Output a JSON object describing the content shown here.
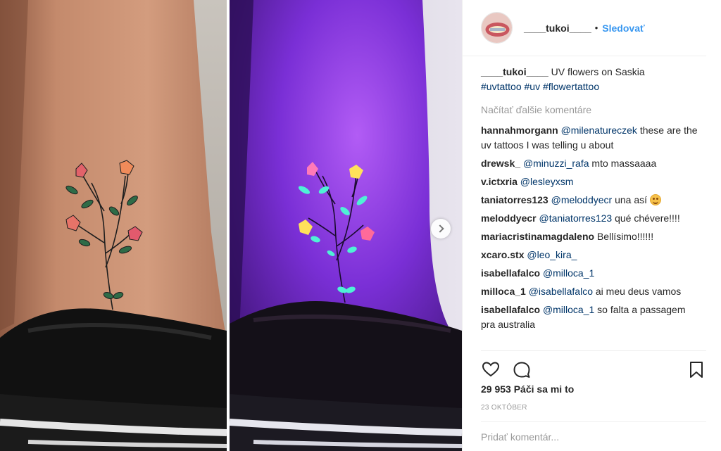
{
  "post": {
    "username": "____tukoi____",
    "separator": "•",
    "follow_label": "Sledovať",
    "caption_text": "UV flowers on Saskia",
    "caption_tags": [
      "#uvtattoo",
      "#uv",
      "#flowertattoo"
    ],
    "load_more_label": "Načítať ďalšie komentáre",
    "comments": [
      {
        "user": "hannahmorgann",
        "mention": "@milenatureczek",
        "text": " these are the uv tattoos I was telling u about"
      },
      {
        "user": "drewsk_",
        "mention": "@minuzzi_rafa",
        "text": " mto massaaaa"
      },
      {
        "user": "v.ictxria",
        "mention": "@lesleyxsm",
        "text": ""
      },
      {
        "user": "taniatorres123",
        "mention": "@meloddyecr",
        "text": " una así "
      },
      {
        "user": "meloddyecr",
        "mention": "@taniatorres123",
        "text": " qué chévere!!!!"
      },
      {
        "user": "mariacristinamagdaleno",
        "mention": "",
        "text": "Bellísimo!!!!!!"
      },
      {
        "user": "xcaro.stx",
        "mention": "@leo_kira_",
        "text": ""
      },
      {
        "user": "isabellafalco",
        "mention": "@milloca_1",
        "text": ""
      },
      {
        "user": "milloca_1",
        "mention": "@isabellafalco",
        "text": " ai meu deus vamos"
      },
      {
        "user": "isabellafalco",
        "mention": "@milloca_1",
        "text": " so falta a passagem pra australia"
      }
    ],
    "likes": "29 953 Páči sa mi to",
    "date": "23 OKTÓBER",
    "add_comment_placeholder": "Pridať komentár..."
  },
  "colors": {
    "link": "#3897f0",
    "mention": "#003569",
    "muted": "#999999",
    "uv_glow": "#b14bff"
  },
  "icons": [
    "heart-icon",
    "comment-icon",
    "bookmark-icon",
    "chevron-right-icon",
    "smiling-emoji-icon"
  ]
}
